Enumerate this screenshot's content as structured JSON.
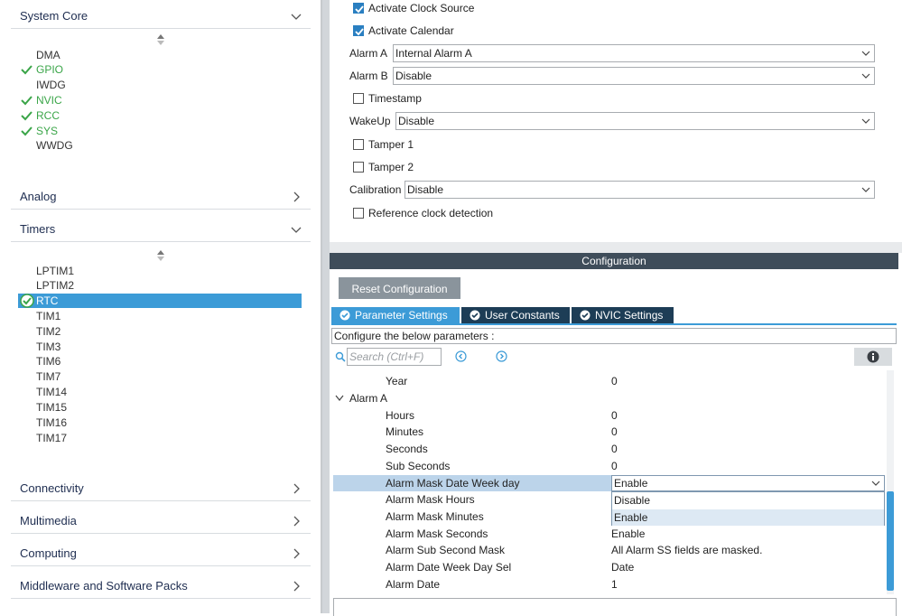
{
  "left": {
    "categories": {
      "system_core": "System Core",
      "analog": "Analog",
      "timers": "Timers",
      "connectivity": "Connectivity",
      "multimedia": "Multimedia",
      "computing": "Computing",
      "middleware": "Middleware and Software Packs"
    },
    "system_core_items": [
      "DMA",
      "GPIO",
      "IWDG",
      "NVIC",
      "RCC",
      "SYS",
      "WWDG"
    ],
    "timers_items": [
      "LPTIM1",
      "LPTIM2",
      "RTC",
      "TIM1",
      "TIM2",
      "TIM3",
      "TIM6",
      "TIM7",
      "TIM14",
      "TIM15",
      "TIM16",
      "TIM17"
    ],
    "enabled_color": "#3aa548",
    "selected_color": "#3c9bd7"
  },
  "mode": {
    "activate_clock_source": "Activate Clock Source",
    "activate_calendar": "Activate Calendar",
    "alarm_a_label": "Alarm A",
    "alarm_a_value": "Internal Alarm A",
    "alarm_b_label": "Alarm B",
    "alarm_b_value": "Disable",
    "timestamp": "Timestamp",
    "wakeup_label": "WakeUp",
    "wakeup_value": "Disable",
    "tamper1": "Tamper 1",
    "tamper2": "Tamper 2",
    "calibration_label": "Calibration",
    "calibration_value": "Disable",
    "ref_clock": "Reference clock detection"
  },
  "config": {
    "title": "Configuration",
    "reset_button": "Reset Configuration",
    "tabs": [
      "Parameter Settings",
      "User Constants",
      "NVIC Settings"
    ],
    "configure_label": "Configure the below parameters :",
    "search_placeholder": "Search (Ctrl+F)",
    "params": [
      {
        "name": "Year",
        "value": "0"
      },
      {
        "name": "Alarm A",
        "value": ""
      },
      {
        "name": "Hours",
        "value": "0"
      },
      {
        "name": "Minutes",
        "value": "0"
      },
      {
        "name": "Seconds",
        "value": "0"
      },
      {
        "name": "Sub Seconds",
        "value": "0"
      },
      {
        "name": "Alarm Mask Date Week day",
        "value": "Enable"
      },
      {
        "name": "Alarm Mask Hours",
        "value": ""
      },
      {
        "name": "Alarm Mask Minutes",
        "value": ""
      },
      {
        "name": "Alarm Mask Seconds",
        "value": "Enable"
      },
      {
        "name": "Alarm Sub Second Mask",
        "value": "All Alarm SS fields are masked."
      },
      {
        "name": "Alarm Date Week Day Sel",
        "value": "Date"
      },
      {
        "name": "Alarm Date",
        "value": "1"
      }
    ],
    "dropdown_options": [
      "Disable",
      "Enable"
    ]
  }
}
